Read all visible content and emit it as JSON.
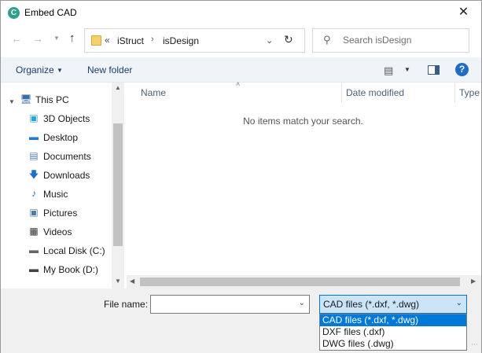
{
  "window": {
    "title": "Embed CAD",
    "app_icon_letter": "C",
    "close_glyph": "✕"
  },
  "address": {
    "overflow": "«",
    "breadcrumbs": [
      "iStruct",
      "isDesign"
    ],
    "separator": "›"
  },
  "search": {
    "placeholder": "Search isDesign",
    "value": ""
  },
  "toolbar": {
    "organize_label": "Organize",
    "new_folder_label": "New folder"
  },
  "nav_pane": {
    "items": [
      {
        "label": "This PC",
        "icon": "computer-icon"
      },
      {
        "label": "3D Objects",
        "icon": "cube-icon"
      },
      {
        "label": "Desktop",
        "icon": "desktop-icon"
      },
      {
        "label": "Documents",
        "icon": "document-icon"
      },
      {
        "label": "Downloads",
        "icon": "download-icon"
      },
      {
        "label": "Music",
        "icon": "music-icon"
      },
      {
        "label": "Pictures",
        "icon": "picture-icon"
      },
      {
        "label": "Videos",
        "icon": "video-icon"
      },
      {
        "label": "Local Disk (C:)",
        "icon": "drive-icon"
      },
      {
        "label": "My Book (D:)",
        "icon": "drive-icon"
      }
    ]
  },
  "file_list": {
    "columns": [
      "Name",
      "Date modified",
      "Type"
    ],
    "empty_message": "No items match your search."
  },
  "bottom": {
    "file_name_label": "File name:",
    "file_name_value": "",
    "file_type_selected": "CAD files (*.dxf, *.dwg)",
    "file_type_options": [
      "CAD files (*.dxf, *.dwg)",
      "DXF files (.dxf)",
      "DWG files (.dwg)"
    ]
  },
  "colors": {
    "accent": "#0078d7",
    "selection_bg": "#cce4f7",
    "link_text": "#1a3c6e",
    "help_blue": "#1f6cc7"
  }
}
